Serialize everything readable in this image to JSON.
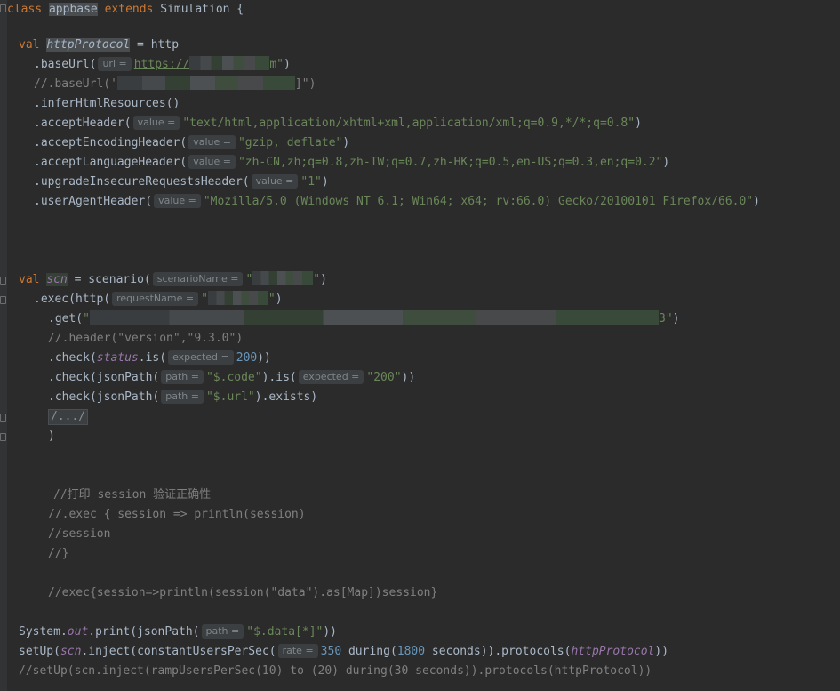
{
  "editor": {
    "lines": [
      {
        "t": 0,
        "l": 8,
        "segs": [
          [
            "kw",
            "class "
          ],
          [
            "hl-a",
            "appbase"
          ],
          [
            "kw",
            " extends "
          ],
          [
            "",
            "Simulation {"
          ]
        ]
      },
      {
        "t": 40,
        "l": 21,
        "segs": [
          [
            "kw",
            "val "
          ],
          [
            "fld hl-a",
            "httpProtocol"
          ],
          [
            "",
            " = http"
          ]
        ]
      },
      {
        "t": 62,
        "l": 38,
        "segs": [
          [
            "",
            ".baseUrl("
          ],
          [
            "hint",
            "url ="
          ],
          [
            "link",
            "https://"
          ],
          [
            "redact",
            ""
          ],
          [
            "str",
            "m\""
          ],
          [
            "",
            ")"
          ]
        ]
      },
      {
        "t": 84,
        "l": 38,
        "segs": [
          [
            "cmt",
            "//.baseUrl('"
          ],
          [
            "redact",
            ""
          ],
          [
            "cmt",
            "]\")"
          ]
        ]
      },
      {
        "t": 106,
        "l": 38,
        "segs": [
          [
            "",
            ".inferHtmlResources()"
          ]
        ]
      },
      {
        "t": 128,
        "l": 38,
        "segs": [
          [
            "",
            ".acceptHeader("
          ],
          [
            "hint",
            "value ="
          ],
          [
            "str",
            "\"text/html,application/xhtml+xml,application/xml;q=0.9,*/*;q=0.8\""
          ],
          [
            "",
            ")"
          ]
        ]
      },
      {
        "t": 150,
        "l": 38,
        "segs": [
          [
            "",
            ".acceptEncodingHeader("
          ],
          [
            "hint",
            "value ="
          ],
          [
            "str",
            "\"gzip, deflate\""
          ],
          [
            "",
            ")"
          ]
        ]
      },
      {
        "t": 172,
        "l": 38,
        "segs": [
          [
            "",
            ".acceptLanguageHeader("
          ],
          [
            "hint",
            "value ="
          ],
          [
            "str",
            "\"zh-CN,zh;q=0.8,zh-TW;q=0.7,zh-HK;q=0.5,en-US;q=0.3,en;q=0.2\""
          ],
          [
            "",
            ")"
          ]
        ]
      },
      {
        "t": 194,
        "l": 38,
        "segs": [
          [
            "",
            ".upgradeInsecureRequestsHeader("
          ],
          [
            "hint",
            "value ="
          ],
          [
            "str",
            "\"1\""
          ],
          [
            "",
            ")"
          ]
        ]
      },
      {
        "t": 216,
        "l": 38,
        "segs": [
          [
            "",
            ".userAgentHeader("
          ],
          [
            "hint",
            "value ="
          ],
          [
            "str",
            "\"Mozilla/5.0 (Windows NT 6.1; Win64; x64; rv:66.0) Gecko/20100101 Firefox/66.0\""
          ],
          [
            "",
            ")"
          ]
        ]
      },
      {
        "t": 304,
        "l": 21,
        "segs": [
          [
            "kw",
            "val "
          ],
          [
            "fld hl-v",
            "scn"
          ],
          [
            "",
            " = scenario("
          ],
          [
            "hint",
            "scenarioName ="
          ],
          [
            "str",
            "\""
          ],
          [
            "redact",
            ""
          ],
          [
            "str",
            "\""
          ],
          [
            "",
            ")"
          ]
        ]
      },
      {
        "t": 326,
        "l": 38,
        "segs": [
          [
            "",
            ".exec(http("
          ],
          [
            "hint",
            "requestName ="
          ],
          [
            "str",
            "\""
          ],
          [
            "redact",
            ""
          ],
          [
            "str",
            "\""
          ],
          [
            "",
            ")"
          ]
        ]
      },
      {
        "t": 348,
        "l": 54,
        "segs": [
          [
            "",
            ".get("
          ],
          [
            "str",
            "\""
          ],
          [
            "redact",
            ""
          ],
          [
            "str",
            "3\""
          ],
          [
            "",
            ")"
          ]
        ]
      },
      {
        "t": 370,
        "l": 54,
        "segs": [
          [
            "cmt",
            "//.header(\"version\",\"9.3.0\")"
          ]
        ]
      },
      {
        "t": 392,
        "l": 54,
        "segs": [
          [
            "",
            ".check("
          ],
          [
            "fld",
            "status"
          ],
          [
            "",
            ".is("
          ],
          [
            "hint",
            "expected ="
          ],
          [
            "num",
            "200"
          ],
          [
            "",
            "))"
          ]
        ]
      },
      {
        "t": 414,
        "l": 54,
        "segs": [
          [
            "",
            ".check(jsonPath("
          ],
          [
            "hint",
            "path ="
          ],
          [
            "str",
            "\"$.code\""
          ],
          [
            "",
            ").is("
          ],
          [
            "hint",
            "expected ="
          ],
          [
            "str",
            "\"200\""
          ],
          [
            "",
            "))"
          ]
        ]
      },
      {
        "t": 436,
        "l": 54,
        "segs": [
          [
            "",
            ".check(jsonPath("
          ],
          [
            "hint",
            "path ="
          ],
          [
            "str",
            "\"$.url\""
          ],
          [
            "",
            ").exists)"
          ]
        ]
      },
      {
        "t": 458,
        "l": 54,
        "segs": [
          [
            "fold-box",
            "/.../"
          ]
        ]
      },
      {
        "t": 480,
        "l": 54,
        "segs": [
          [
            "",
            ")"
          ]
        ]
      },
      {
        "t": 546,
        "l": 60,
        "segs": [
          [
            "cmt",
            "//打印 session 验证正确性"
          ]
        ]
      },
      {
        "t": 568,
        "l": 54,
        "segs": [
          [
            "cmt",
            "//.exec { session => println(session)"
          ]
        ]
      },
      {
        "t": 590,
        "l": 54,
        "segs": [
          [
            "cmt",
            "//session"
          ]
        ]
      },
      {
        "t": 612,
        "l": 54,
        "segs": [
          [
            "cmt",
            "//}"
          ]
        ]
      },
      {
        "t": 656,
        "l": 54,
        "segs": [
          [
            "cmt",
            "//exec{session=>println(session(\"data\").as[Map])session}"
          ]
        ]
      },
      {
        "t": 700,
        "l": 21,
        "segs": [
          [
            "",
            "System."
          ],
          [
            "fld",
            "out"
          ],
          [
            "",
            ".print(jsonPath("
          ],
          [
            "hint",
            "path ="
          ],
          [
            "str",
            "\"$.data[*]\""
          ],
          [
            "",
            "))"
          ]
        ]
      },
      {
        "t": 722,
        "l": 21,
        "segs": [
          [
            "",
            "setUp("
          ],
          [
            "fld",
            "scn"
          ],
          [
            "",
            ".inject(constantUsersPerSec("
          ],
          [
            "hint",
            "rate ="
          ],
          [
            "num",
            "350"
          ],
          [
            "",
            " during("
          ],
          [
            "num",
            "1800"
          ],
          [
            "",
            " seconds)).protocols("
          ],
          [
            "fld",
            "httpProtocol"
          ],
          [
            "",
            "))"
          ]
        ]
      },
      {
        "t": 744,
        "l": 21,
        "segs": [
          [
            "cmt",
            "//setUp(scn.inject(rampUsersPerSec(10) to (20) during(30 seconds)).protocols(httpProtocol))"
          ]
        ]
      }
    ]
  }
}
